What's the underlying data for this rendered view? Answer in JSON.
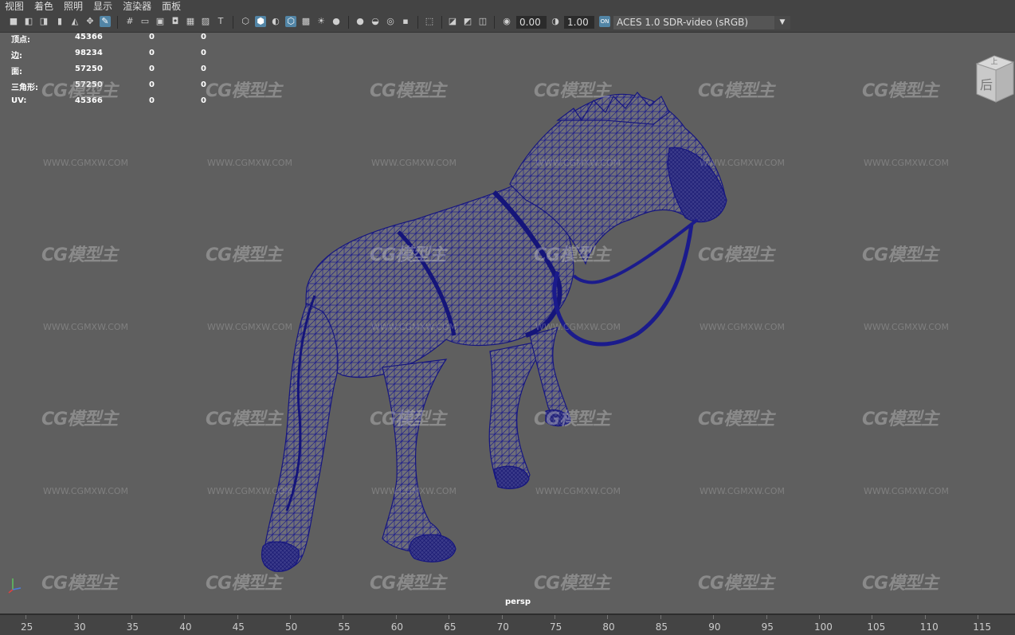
{
  "menu": [
    "视图",
    "着色",
    "照明",
    "显示",
    "渲染器",
    "面板"
  ],
  "toolbar": {
    "exposure_value": "0.00",
    "gamma_value": "1.00",
    "colorspace_badge": "ON",
    "colorspace": "ACES 1.0 SDR-video (sRGB)"
  },
  "hud": {
    "rows": [
      {
        "label": "顶点:",
        "v1": "45366",
        "v2": "0",
        "v3": "0"
      },
      {
        "label": "边:",
        "v1": "98234",
        "v2": "0",
        "v3": "0"
      },
      {
        "label": "面:",
        "v1": "57250",
        "v2": "0",
        "v3": "0"
      },
      {
        "label": "三角形:",
        "v1": "57250",
        "v2": "0",
        "v3": "0"
      },
      {
        "label": "UV:",
        "v1": "45366",
        "v2": "0",
        "v3": "0"
      }
    ]
  },
  "watermark": {
    "logo": "CG模型主",
    "url": "WWW.CGMXW.COM"
  },
  "viewport": {
    "camera": "persp",
    "viewcube_face": "后",
    "viewcube_top": "上",
    "wire_color": "#1a1a8a"
  },
  "timeline": {
    "ticks": [
      "25",
      "30",
      "35",
      "40",
      "45",
      "50",
      "55",
      "60",
      "65",
      "70",
      "75",
      "80",
      "85",
      "90",
      "95",
      "100",
      "105",
      "110",
      "115"
    ]
  },
  "colors": {
    "background": "#5f5f5f",
    "toolbar": "#444444",
    "active": "#5285a6"
  }
}
